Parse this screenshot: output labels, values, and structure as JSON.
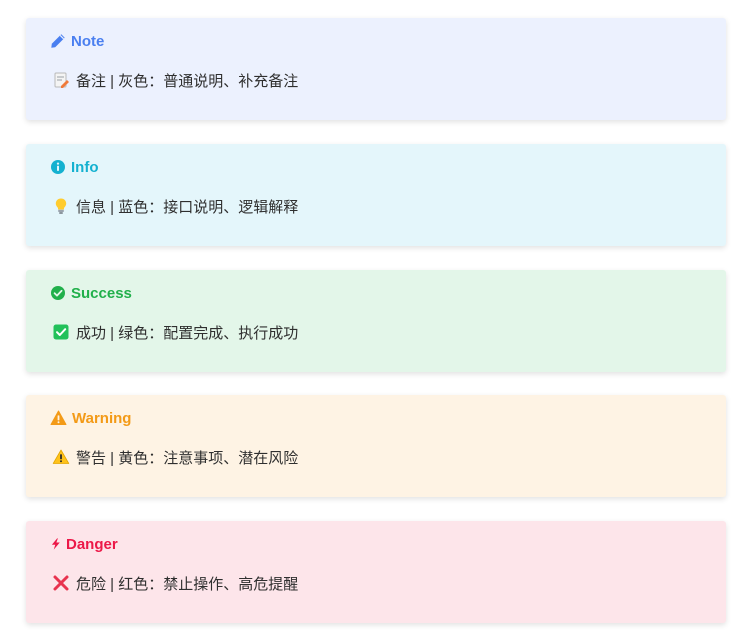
{
  "callouts": [
    {
      "title": "Note",
      "icon": "pencil-icon",
      "emoji": "memo-icon",
      "text": "备注 | 灰色：普通说明、补充备注",
      "color": "#4a7ff0",
      "background": "#ecf1fe"
    },
    {
      "title": "Info",
      "icon": "info-circle-icon",
      "emoji": "lightbulb-icon",
      "text": "信息 | 蓝色：接口说明、逻辑解释",
      "color": "#14b1d0",
      "background": "#e4f6fb"
    },
    {
      "title": "Success",
      "icon": "check-circle-icon",
      "emoji": "check-box-icon",
      "text": "成功 | 绿色：配置完成、执行成功",
      "color": "#21b04b",
      "background": "#e3f6e9"
    },
    {
      "title": "Warning",
      "icon": "warning-triangle-icon",
      "emoji": "warning-sign-icon",
      "text": "警告 | 黄色：注意事项、潜在风险",
      "color": "#f39a17",
      "background": "#fef3e4"
    },
    {
      "title": "Danger",
      "icon": "bolt-icon",
      "emoji": "cross-mark-icon",
      "text": "危险 | 红色：禁止操作、高危提醒",
      "color": "#ec1848",
      "background": "#fde5ea"
    }
  ]
}
